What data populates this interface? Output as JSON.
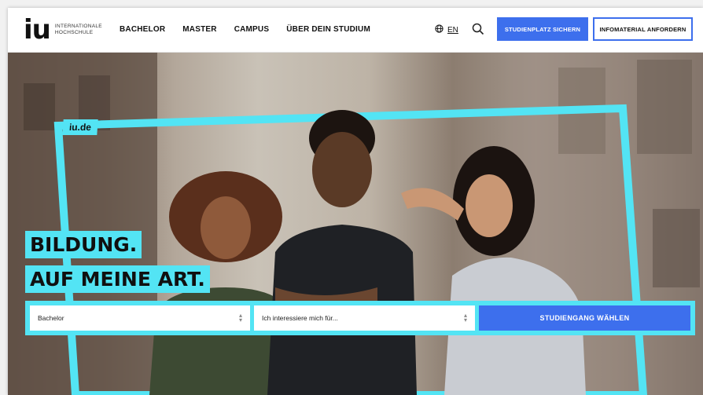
{
  "header": {
    "logo_mark": "iu",
    "logo_line1": "INTERNATIONALE",
    "logo_line2": "HOCHSCHULE",
    "nav": [
      "BACHELOR",
      "MASTER",
      "CAMPUS",
      "ÜBER DEIN STUDIUM"
    ],
    "language": "EN",
    "cta_primary": "STUDIENPLATZ SICHERN",
    "cta_secondary": "INFOMATERIAL ANFORDERN"
  },
  "hero": {
    "frame_tab": "iu.de",
    "headline_line1": "BILDUNG.",
    "headline_line2": "AUF MEINE ART.",
    "degree_select_value": "Bachelor",
    "interest_select_value": "Ich interessiere mich für...",
    "submit_label": "STUDIENGANG WÄHLEN"
  },
  "colors": {
    "accent_cyan": "#53e4f4",
    "brand_blue": "#3d6fed"
  },
  "icons": [
    "globe-icon",
    "search-icon",
    "chevron-updown-icon"
  ]
}
